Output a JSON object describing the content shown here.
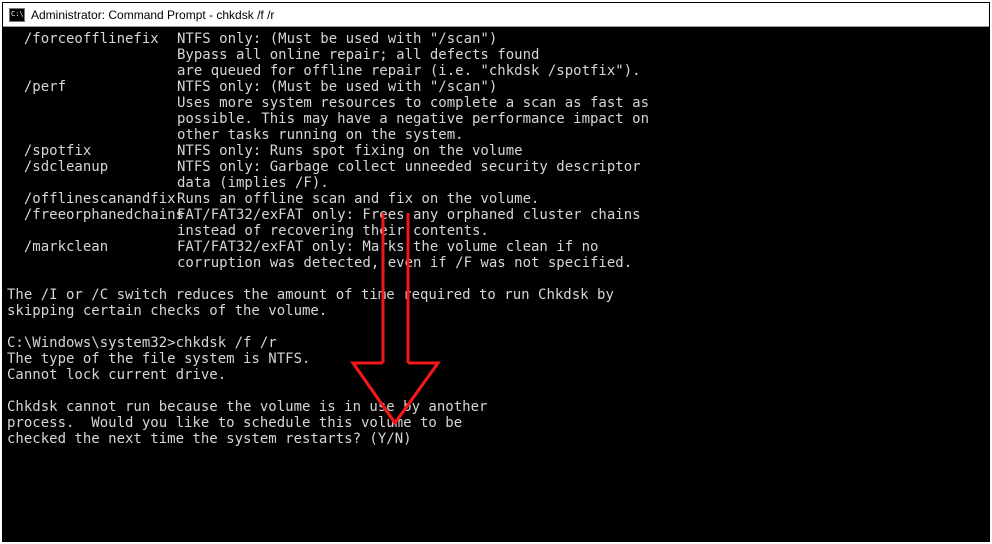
{
  "window": {
    "title": "Administrator: Command Prompt - chkdsk  /f /r"
  },
  "options": [
    {
      "flag": "  /forceofflinefix",
      "desc": "NTFS only: (Must be used with \"/scan\")"
    },
    {
      "flag": "",
      "desc": "Bypass all online repair; all defects found"
    },
    {
      "flag": "",
      "desc": "are queued for offline repair (i.e. \"chkdsk /spotfix\")."
    },
    {
      "flag": "  /perf",
      "desc": "NTFS only: (Must be used with \"/scan\")"
    },
    {
      "flag": "",
      "desc": "Uses more system resources to complete a scan as fast as"
    },
    {
      "flag": "",
      "desc": "possible. This may have a negative performance impact on"
    },
    {
      "flag": "",
      "desc": "other tasks running on the system."
    },
    {
      "flag": "  /spotfix",
      "desc": "NTFS only: Runs spot fixing on the volume"
    },
    {
      "flag": "  /sdcleanup",
      "desc": "NTFS only: Garbage collect unneeded security descriptor"
    },
    {
      "flag": "",
      "desc": "data (implies /F)."
    },
    {
      "flag": "  /offlinescanandfix",
      "desc": "Runs an offline scan and fix on the volume."
    },
    {
      "flag": "  /freeorphanedchains",
      "desc": "FAT/FAT32/exFAT only: Frees any orphaned cluster chains"
    },
    {
      "flag": "",
      "desc": "instead of recovering their contents."
    },
    {
      "flag": "  /markclean",
      "desc": "FAT/FAT32/exFAT only: Marks the volume clean if no"
    },
    {
      "flag": "",
      "desc": "corruption was detected, even if /F was not specified."
    }
  ],
  "body_lines": [
    "",
    "The /I or /C switch reduces the amount of time required to run Chkdsk by",
    "skipping certain checks of the volume.",
    "",
    "C:\\Windows\\system32>chkdsk /f /r",
    "The type of the file system is NTFS.",
    "Cannot lock current drive.",
    "",
    "Chkdsk cannot run because the volume is in use by another",
    "process.  Would you like to schedule this volume to be",
    "checked the next time the system restarts? (Y/N)"
  ],
  "annotation": {
    "name": "red-arrow"
  }
}
